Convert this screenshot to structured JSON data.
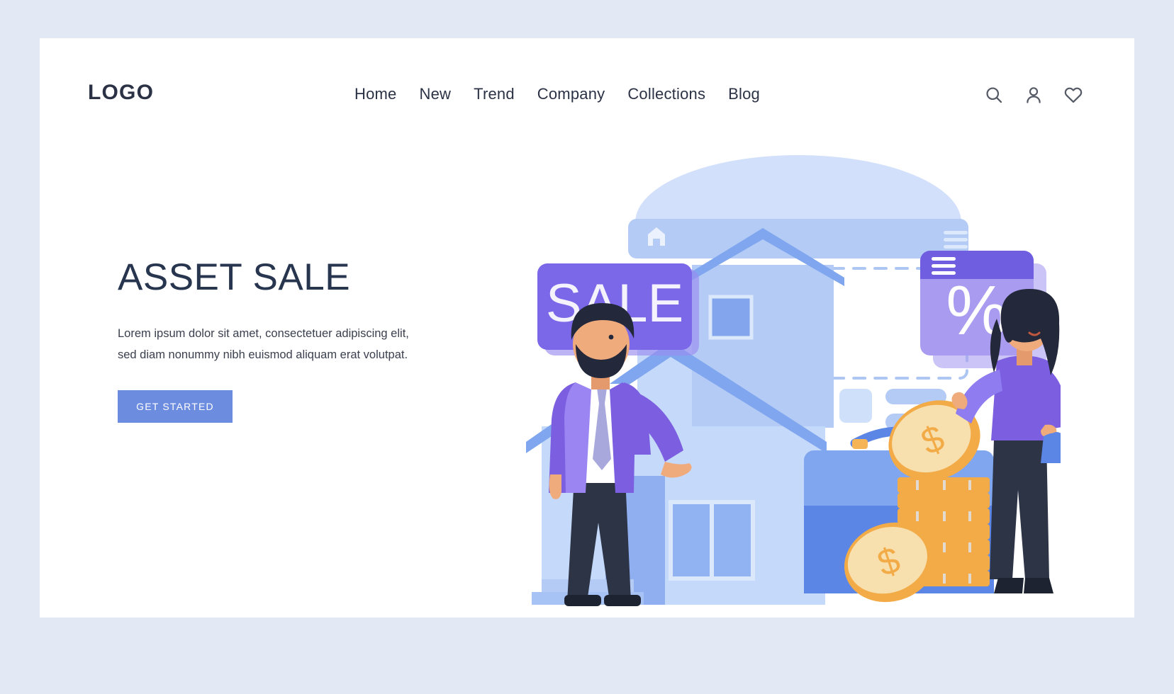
{
  "brand": {
    "logo_text": "LOGO"
  },
  "nav": {
    "items": [
      {
        "label": "Home"
      },
      {
        "label": "New"
      },
      {
        "label": "Trend"
      },
      {
        "label": "Company"
      },
      {
        "label": "Collections"
      },
      {
        "label": "Blog"
      }
    ]
  },
  "header_icons": [
    {
      "name": "search-icon"
    },
    {
      "name": "user-icon"
    },
    {
      "name": "heart-icon"
    }
  ],
  "hero": {
    "title": "ASSET SALE",
    "description": "Lorem ipsum dolor sit amet, consectetuer adipiscing elit, sed diam nonummy nibh euismod aliquam erat volutpat.",
    "cta_label": "GET STARTED"
  },
  "illustration": {
    "sale_banner_text": "SALE",
    "percent_card_text": "%",
    "coin_symbol": "$",
    "browser_home_icon": "home-icon",
    "menu_icon": "hamburger-icon"
  },
  "colors": {
    "page_background": "#e3e8f5",
    "card_background": "#ffffff",
    "text_dark": "#27354f",
    "nav_text": "#2b3245",
    "cta_button": "#6c8ce0",
    "accent_purple": "#7b68e8",
    "purple_light": "#a99cf0",
    "blue_light": "#b4cbf5",
    "blue_mid": "#7fa6ee",
    "blue_deep": "#5b86e5",
    "coin_gold": "#f5b557",
    "coin_face": "#f7dfae",
    "navy_pants": "#2c3446",
    "skin": "#f0ab7d"
  }
}
